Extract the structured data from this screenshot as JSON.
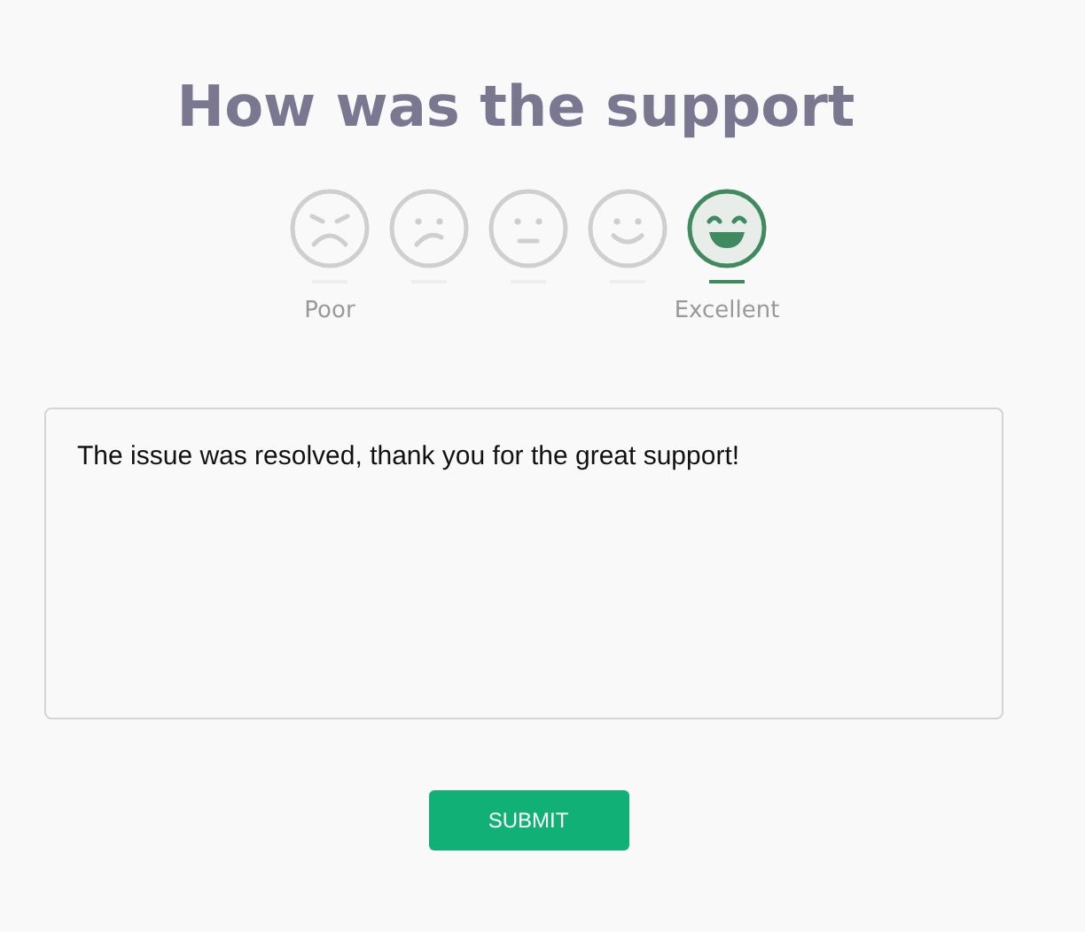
{
  "title": "How was the support",
  "ratings": [
    {
      "kind": "angry",
      "selected": false,
      "label": "Poor"
    },
    {
      "kind": "sad",
      "selected": false
    },
    {
      "kind": "neutral",
      "selected": false
    },
    {
      "kind": "smile",
      "selected": false
    },
    {
      "kind": "grin",
      "selected": true,
      "label": "Excellent"
    }
  ],
  "comment": {
    "value": "The issue was resolved, thank you for the great support!"
  },
  "submit_button": "SUBMIT"
}
